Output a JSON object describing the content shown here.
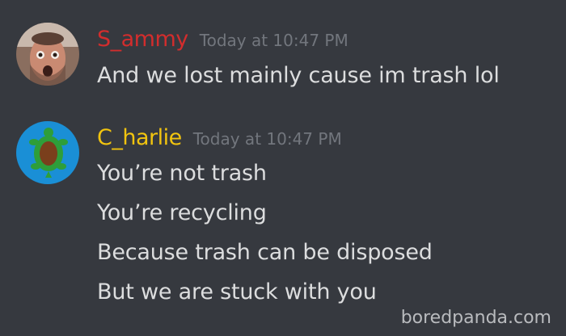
{
  "colors": {
    "background": "#36393f",
    "message_text": "#dcddde",
    "timestamp": "#72767d",
    "watermark": "#b9bbbe"
  },
  "messages": [
    {
      "username": "S_ammy",
      "username_color": "#d22d2d",
      "timestamp": "Today at 10:47 PM",
      "avatar_icon": "user-photo-avatar",
      "lines": [
        "And we lost mainly cause im trash lol"
      ]
    },
    {
      "username": "C_harlie",
      "username_color": "#f1c40f",
      "timestamp": "Today at 10:47 PM",
      "avatar_icon": "turtle-avatar",
      "lines": [
        "You’re not trash",
        "You’re recycling",
        "Because trash can be disposed",
        "But we are stuck with you"
      ]
    }
  ],
  "watermark": "boredpanda.com"
}
